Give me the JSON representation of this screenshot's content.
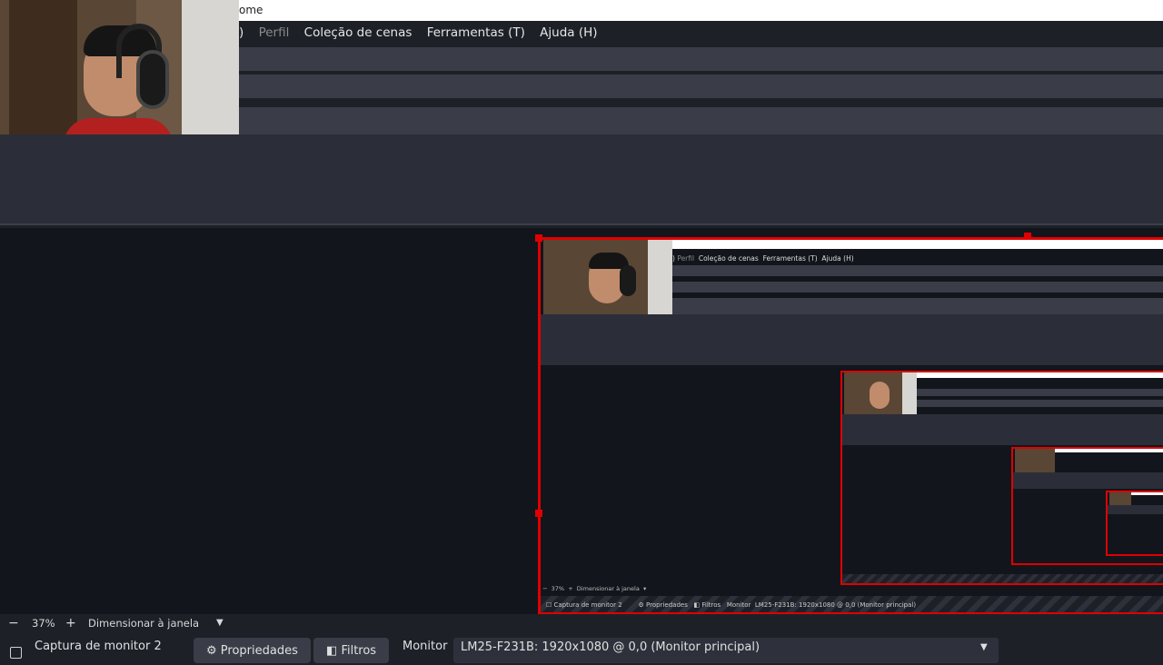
{
  "window": {
    "title_fragment": "ome"
  },
  "menu": {
    "items": [
      {
        "label": ")",
        "dim": false
      },
      {
        "label": "Perfil",
        "dim": true
      },
      {
        "label": "Coleção de cenas",
        "dim": false
      },
      {
        "label": "Ferramentas (T)",
        "dim": false
      },
      {
        "label": "Ajuda (H)",
        "dim": false
      }
    ]
  },
  "status": {
    "zoom_out_icon": "minus-icon",
    "zoom": "37%",
    "zoom_in_icon": "plus-icon",
    "fit_label": "Dimensionar à janela",
    "dropdown_icon": "caret-down-icon"
  },
  "source_bar": {
    "source_name": "Captura de monitor 2",
    "properties_label": "Propriedades",
    "filters_label": "Filtros",
    "monitor_label": "Monitor",
    "monitor_value": "LM25-F231B: 1920x1080 @ 0,0 (Monitor principal)"
  },
  "colors": {
    "accent": "#e00000",
    "background": "#1e2028",
    "preview_bg": "#13151c"
  }
}
